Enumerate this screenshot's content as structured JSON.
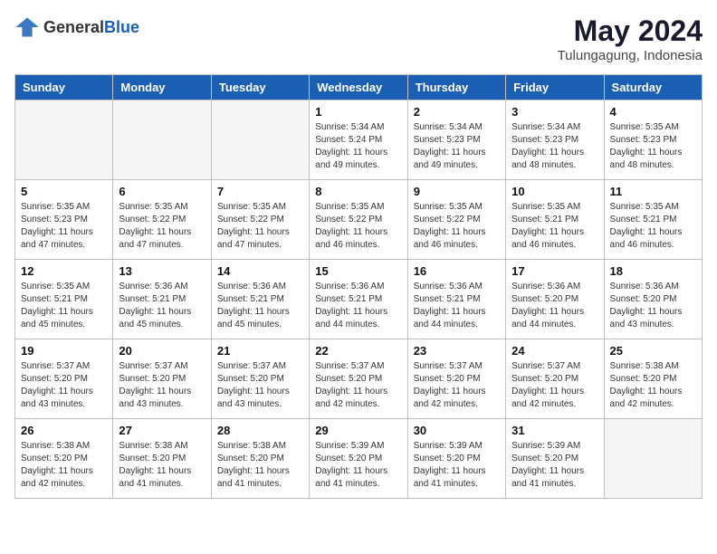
{
  "logo": {
    "general": "General",
    "blue": "Blue"
  },
  "header": {
    "month_year": "May 2024",
    "location": "Tulungagung, Indonesia"
  },
  "days_of_week": [
    "Sunday",
    "Monday",
    "Tuesday",
    "Wednesday",
    "Thursday",
    "Friday",
    "Saturday"
  ],
  "weeks": [
    [
      {
        "day": "",
        "info": ""
      },
      {
        "day": "",
        "info": ""
      },
      {
        "day": "",
        "info": ""
      },
      {
        "day": "1",
        "info": "Sunrise: 5:34 AM\nSunset: 5:24 PM\nDaylight: 11 hours\nand 49 minutes."
      },
      {
        "day": "2",
        "info": "Sunrise: 5:34 AM\nSunset: 5:23 PM\nDaylight: 11 hours\nand 49 minutes."
      },
      {
        "day": "3",
        "info": "Sunrise: 5:34 AM\nSunset: 5:23 PM\nDaylight: 11 hours\nand 48 minutes."
      },
      {
        "day": "4",
        "info": "Sunrise: 5:35 AM\nSunset: 5:23 PM\nDaylight: 11 hours\nand 48 minutes."
      }
    ],
    [
      {
        "day": "5",
        "info": "Sunrise: 5:35 AM\nSunset: 5:23 PM\nDaylight: 11 hours\nand 47 minutes."
      },
      {
        "day": "6",
        "info": "Sunrise: 5:35 AM\nSunset: 5:22 PM\nDaylight: 11 hours\nand 47 minutes."
      },
      {
        "day": "7",
        "info": "Sunrise: 5:35 AM\nSunset: 5:22 PM\nDaylight: 11 hours\nand 47 minutes."
      },
      {
        "day": "8",
        "info": "Sunrise: 5:35 AM\nSunset: 5:22 PM\nDaylight: 11 hours\nand 46 minutes."
      },
      {
        "day": "9",
        "info": "Sunrise: 5:35 AM\nSunset: 5:22 PM\nDaylight: 11 hours\nand 46 minutes."
      },
      {
        "day": "10",
        "info": "Sunrise: 5:35 AM\nSunset: 5:21 PM\nDaylight: 11 hours\nand 46 minutes."
      },
      {
        "day": "11",
        "info": "Sunrise: 5:35 AM\nSunset: 5:21 PM\nDaylight: 11 hours\nand 46 minutes."
      }
    ],
    [
      {
        "day": "12",
        "info": "Sunrise: 5:35 AM\nSunset: 5:21 PM\nDaylight: 11 hours\nand 45 minutes."
      },
      {
        "day": "13",
        "info": "Sunrise: 5:36 AM\nSunset: 5:21 PM\nDaylight: 11 hours\nand 45 minutes."
      },
      {
        "day": "14",
        "info": "Sunrise: 5:36 AM\nSunset: 5:21 PM\nDaylight: 11 hours\nand 45 minutes."
      },
      {
        "day": "15",
        "info": "Sunrise: 5:36 AM\nSunset: 5:21 PM\nDaylight: 11 hours\nand 44 minutes."
      },
      {
        "day": "16",
        "info": "Sunrise: 5:36 AM\nSunset: 5:21 PM\nDaylight: 11 hours\nand 44 minutes."
      },
      {
        "day": "17",
        "info": "Sunrise: 5:36 AM\nSunset: 5:20 PM\nDaylight: 11 hours\nand 44 minutes."
      },
      {
        "day": "18",
        "info": "Sunrise: 5:36 AM\nSunset: 5:20 PM\nDaylight: 11 hours\nand 43 minutes."
      }
    ],
    [
      {
        "day": "19",
        "info": "Sunrise: 5:37 AM\nSunset: 5:20 PM\nDaylight: 11 hours\nand 43 minutes."
      },
      {
        "day": "20",
        "info": "Sunrise: 5:37 AM\nSunset: 5:20 PM\nDaylight: 11 hours\nand 43 minutes."
      },
      {
        "day": "21",
        "info": "Sunrise: 5:37 AM\nSunset: 5:20 PM\nDaylight: 11 hours\nand 43 minutes."
      },
      {
        "day": "22",
        "info": "Sunrise: 5:37 AM\nSunset: 5:20 PM\nDaylight: 11 hours\nand 42 minutes."
      },
      {
        "day": "23",
        "info": "Sunrise: 5:37 AM\nSunset: 5:20 PM\nDaylight: 11 hours\nand 42 minutes."
      },
      {
        "day": "24",
        "info": "Sunrise: 5:37 AM\nSunset: 5:20 PM\nDaylight: 11 hours\nand 42 minutes."
      },
      {
        "day": "25",
        "info": "Sunrise: 5:38 AM\nSunset: 5:20 PM\nDaylight: 11 hours\nand 42 minutes."
      }
    ],
    [
      {
        "day": "26",
        "info": "Sunrise: 5:38 AM\nSunset: 5:20 PM\nDaylight: 11 hours\nand 42 minutes."
      },
      {
        "day": "27",
        "info": "Sunrise: 5:38 AM\nSunset: 5:20 PM\nDaylight: 11 hours\nand 41 minutes."
      },
      {
        "day": "28",
        "info": "Sunrise: 5:38 AM\nSunset: 5:20 PM\nDaylight: 11 hours\nand 41 minutes."
      },
      {
        "day": "29",
        "info": "Sunrise: 5:39 AM\nSunset: 5:20 PM\nDaylight: 11 hours\nand 41 minutes."
      },
      {
        "day": "30",
        "info": "Sunrise: 5:39 AM\nSunset: 5:20 PM\nDaylight: 11 hours\nand 41 minutes."
      },
      {
        "day": "31",
        "info": "Sunrise: 5:39 AM\nSunset: 5:20 PM\nDaylight: 11 hours\nand 41 minutes."
      },
      {
        "day": "",
        "info": ""
      }
    ]
  ]
}
